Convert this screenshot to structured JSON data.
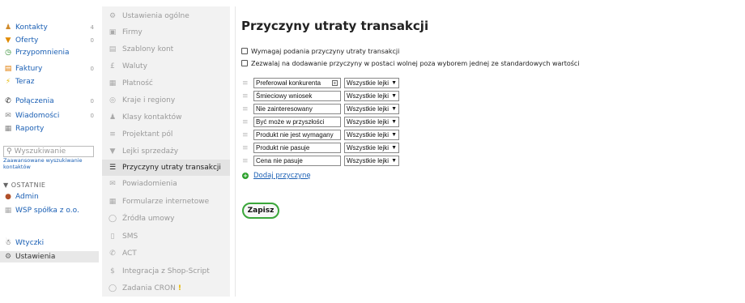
{
  "nav": {
    "items": [
      {
        "label": "Kontakty",
        "count": "4",
        "icon": "contact-icon"
      },
      {
        "label": "Oferty",
        "count": "0",
        "icon": "funnel-icon"
      },
      {
        "label": "Przypomnienia",
        "count": "",
        "icon": "clock-icon"
      },
      {
        "label": "Faktury",
        "count": "0",
        "icon": "invoice-icon"
      },
      {
        "label": "Teraz",
        "count": "",
        "icon": "lightning-icon"
      },
      {
        "label": "Połączenia",
        "count": "0",
        "icon": "phone-icon"
      },
      {
        "label": "Wiadomości",
        "count": "0",
        "icon": "mail-icon"
      },
      {
        "label": "Raporty",
        "count": "",
        "icon": "chart-icon"
      }
    ],
    "search_placeholder": "Wyszukiwanie",
    "advanced_search": "Zaawansowane wyszukiwanie kontaktów",
    "recent_header": "OSTATNIE",
    "recent_items": [
      {
        "label": "Admin",
        "icon": "user-avatar-icon"
      },
      {
        "label": "WSP spółka z o.o.",
        "icon": "company-icon"
      }
    ],
    "plugins": "Wtyczki",
    "settings": "Ustawienia"
  },
  "submenu": {
    "items": [
      {
        "label": "Ustawienia ogólne",
        "icon": "gear-icon"
      },
      {
        "label": "Firmy",
        "icon": "briefcase-icon"
      },
      {
        "label": "Szablony kont",
        "icon": "template-icon"
      },
      {
        "label": "Waluty",
        "icon": "currency-icon"
      },
      {
        "label": "Płatność",
        "icon": "payment-icon"
      },
      {
        "label": "Kraje i regiony",
        "icon": "globe-icon"
      },
      {
        "label": "Klasy kontaktów",
        "icon": "users-icon"
      },
      {
        "label": "Projektant pól",
        "icon": "fields-icon"
      },
      {
        "label": "Lejki sprzedaży",
        "icon": "funnel-icon"
      },
      {
        "label": "Przyczyny utraty transakcji",
        "icon": "list-icon"
      },
      {
        "label": "Powiadomienia",
        "icon": "envelope-icon"
      },
      {
        "label": "Formularze internetowe",
        "icon": "form-icon"
      },
      {
        "label": "Źródła umowy",
        "icon": "source-icon"
      },
      {
        "label": "SMS",
        "icon": "mobile-icon"
      },
      {
        "label": "ACT",
        "icon": "phone-icon"
      },
      {
        "label": "Integracja z Shop-Script",
        "icon": "dollar-icon"
      },
      {
        "label": "Zadania CRON",
        "icon": "cron-icon"
      }
    ],
    "active_index": 9
  },
  "main": {
    "title": "Przyczyny utraty transakcji",
    "checkbox_require": "Wymagaj podania przyczyny utraty transakcji",
    "checkbox_freeform": "Zezwalaj na dodawanie przyczyny w postaci wolnej poza wyborem jednej ze standardowych wartości",
    "reasons": [
      {
        "value": "Preferował konkurenta",
        "funnel": "Wszystkie lejki"
      },
      {
        "value": "Śmieciowy wniosek",
        "funnel": "Wszystkie lejki"
      },
      {
        "value": "Nie zainteresowany",
        "funnel": "Wszystkie lejki"
      },
      {
        "value": "Być może w przyszłości",
        "funnel": "Wszystkie lejki"
      },
      {
        "value": "Produkt nie jest wymagany",
        "funnel": "Wszystkie lejki"
      },
      {
        "value": "Produkt nie pasuje",
        "funnel": "Wszystkie lejki"
      },
      {
        "value": "Cena nie pasuje",
        "funnel": "Wszystkie lejki"
      }
    ],
    "add_reason": "Dodaj przyczynę",
    "save": "Zapisz"
  },
  "colors": {
    "link": "#1a5fb4",
    "save_border": "#3aa63a",
    "add_icon": "#2aa02a",
    "cron_warning": "#e5b700"
  }
}
